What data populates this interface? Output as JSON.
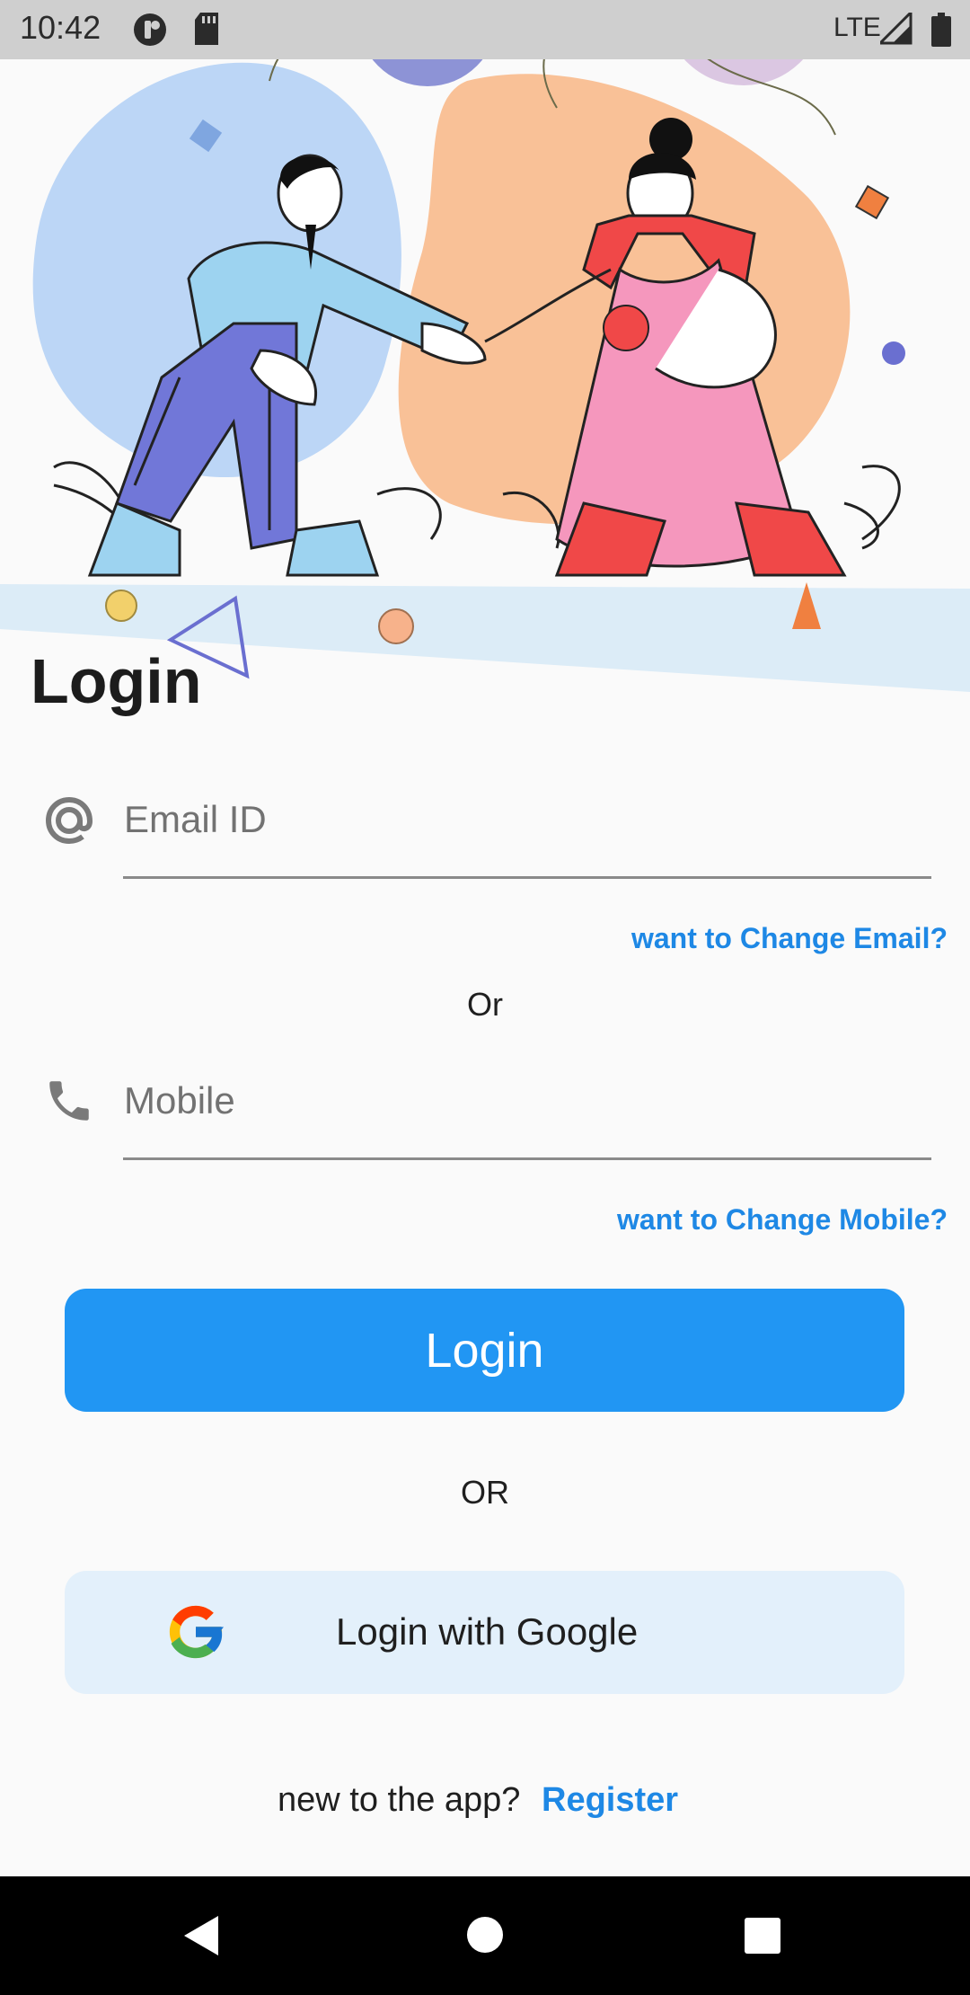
{
  "status_bar": {
    "time": "10:42",
    "network": "LTE"
  },
  "login": {
    "title": "Login",
    "email_placeholder": "Email ID",
    "change_email_link": "want to Change Email?",
    "or_small": "Or",
    "mobile_placeholder": "Mobile",
    "change_mobile_link": "want to Change Mobile?",
    "login_button": "Login",
    "or_caps": "OR",
    "google_button": "Login with Google",
    "new_prompt": "new to the app?",
    "register_link": "Register"
  },
  "colors": {
    "accent": "#2196f3",
    "link": "#1e88e5",
    "google_bg": "#e3f0fb"
  },
  "icons": [
    "at-icon",
    "phone-icon",
    "google-logo-icon",
    "back-icon",
    "home-icon",
    "recents-icon",
    "signal-icon",
    "battery-icon",
    "sd-card-icon"
  ]
}
